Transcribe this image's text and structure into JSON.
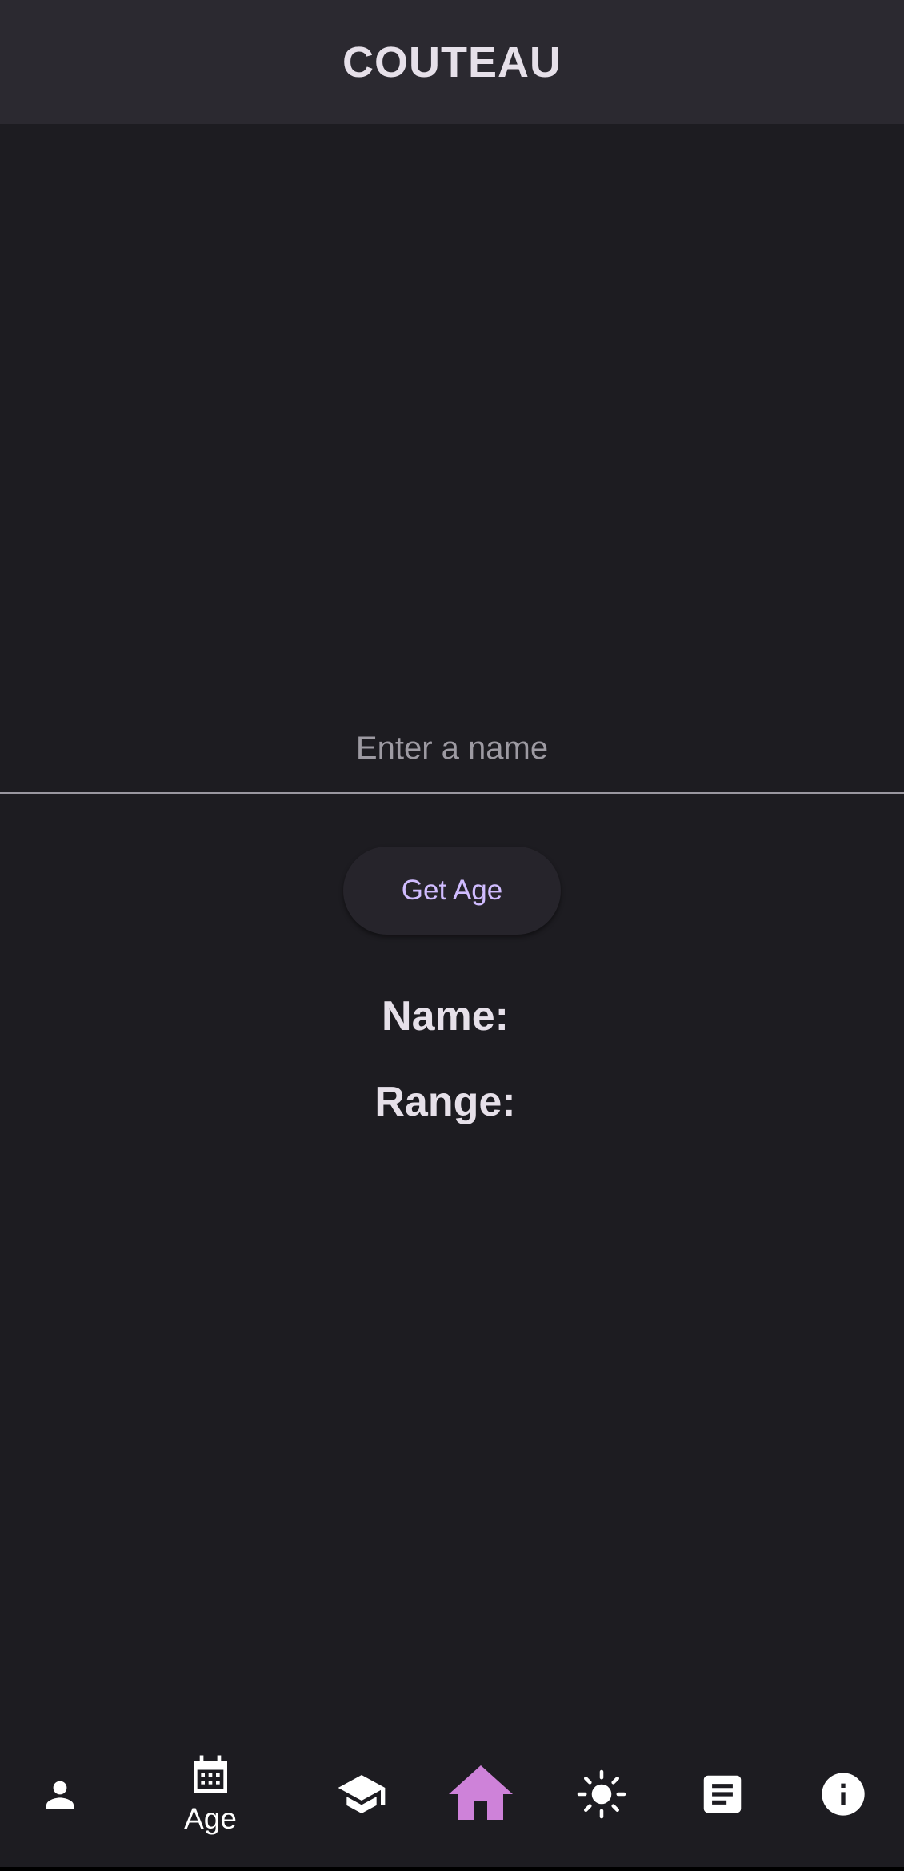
{
  "app_bar": {
    "title": "COUTEAU"
  },
  "form": {
    "name_input": {
      "value": "",
      "placeholder": "Enter a name"
    },
    "get_age_label": "Get Age"
  },
  "results": {
    "name_label": "Name:",
    "range_label": "Range:"
  },
  "bottom_nav": {
    "items": [
      {
        "icon": "person-icon",
        "label": "",
        "selected": false
      },
      {
        "icon": "calendar-icon",
        "label": "Age",
        "selected": true
      },
      {
        "icon": "graduation-cap-icon",
        "label": "",
        "selected": false
      },
      {
        "icon": "home-icon",
        "label": "",
        "selected": false
      },
      {
        "icon": "sun-icon",
        "label": "",
        "selected": false
      },
      {
        "icon": "article-icon",
        "label": "",
        "selected": false
      },
      {
        "icon": "info-icon",
        "label": "",
        "selected": false
      }
    ]
  },
  "colors": {
    "background": "#1d1c21",
    "app_bar": "#2b2930",
    "title_text": "#e6e0e9",
    "button_text": "#d0bcff",
    "home_icon": "#ce82d9",
    "nav_icon": "#ffffff"
  }
}
